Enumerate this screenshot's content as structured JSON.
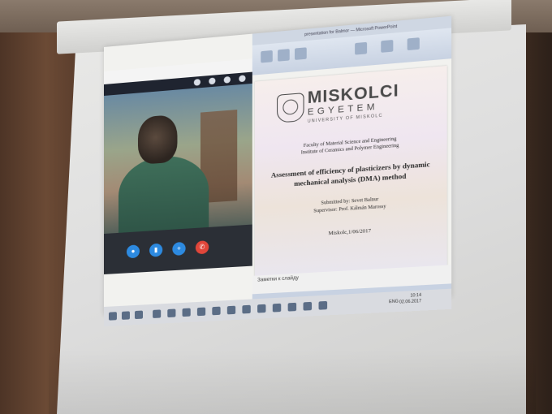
{
  "powerpoint": {
    "window_title": "presentation for Balmor — Microsoft PowerPoint",
    "notes_placeholder": "Заметки к слайду"
  },
  "slide": {
    "logo_line1": "MISKOLCI",
    "logo_line2": "EGYETEM",
    "logo_line3": "UNIVERSITY OF MISKOLC",
    "faculty": "Faculty of Material Science and Engineering",
    "institute": "Institute of Ceramics and Polymer Engineering",
    "title_line1": "Assessment of efficiency of plasticizers by dynamic",
    "title_line2": "mechanical analysis (DMA) method",
    "submitted_by": "Submitted by: Sevet Balnur",
    "supervisor": "Supervisor: Prof. Kálmán Marossy",
    "date": "Miskolc,1/06/2017"
  },
  "taskbar": {
    "language": "ENG",
    "time": "10:14",
    "date": "02.06.2017"
  }
}
